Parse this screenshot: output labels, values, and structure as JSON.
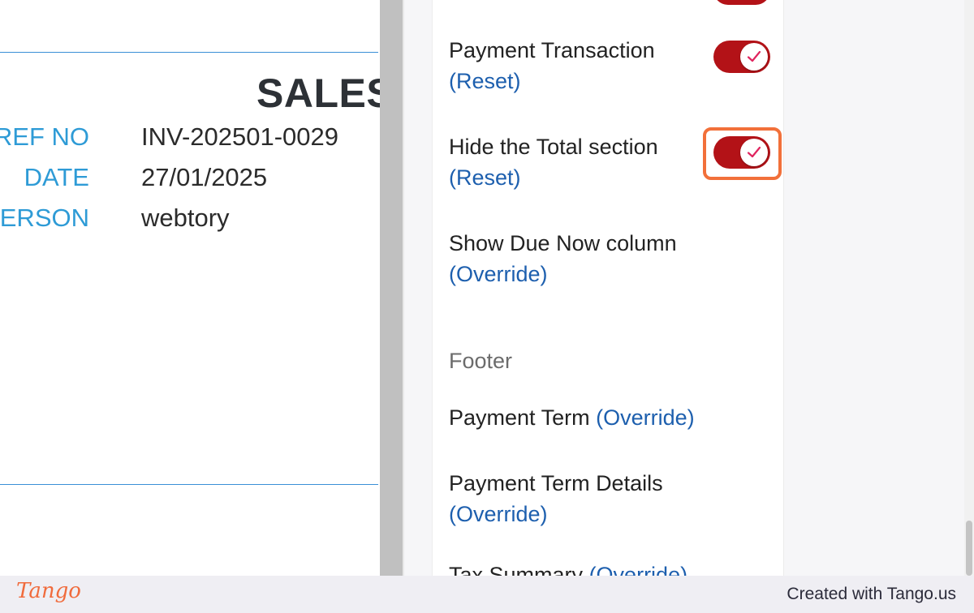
{
  "preview": {
    "title": "SALES",
    "rows": [
      {
        "label": "REF NO",
        "value": "INV-202501-0029"
      },
      {
        "label": "DATE",
        "value": "27/01/2025"
      },
      {
        "label": "ERSON",
        "value": "webtory"
      }
    ]
  },
  "settings": {
    "items": [
      {
        "label": "Payment Transaction",
        "link": "(Reset)",
        "toggle": true
      },
      {
        "label": "Hide the Total section",
        "link": "(Reset)",
        "toggle": true
      },
      {
        "label": "Show Due Now column",
        "link": "(Override)"
      }
    ],
    "footer_section": {
      "title": "Footer",
      "items": [
        {
          "label": "Payment Term",
          "link": "(Override)"
        },
        {
          "label": "Payment Term Details",
          "link": "(Override)"
        },
        {
          "label": "Tax Summary",
          "link": "(Override)"
        }
      ]
    }
  },
  "colors": {
    "toggle_on": "#b31217",
    "link": "#1d5fae",
    "accent": "#2e9bd6",
    "highlight": "#f2703a",
    "check": "#e0245e"
  },
  "footer": {
    "brand": "Tango",
    "credit": "Created with Tango.us"
  }
}
